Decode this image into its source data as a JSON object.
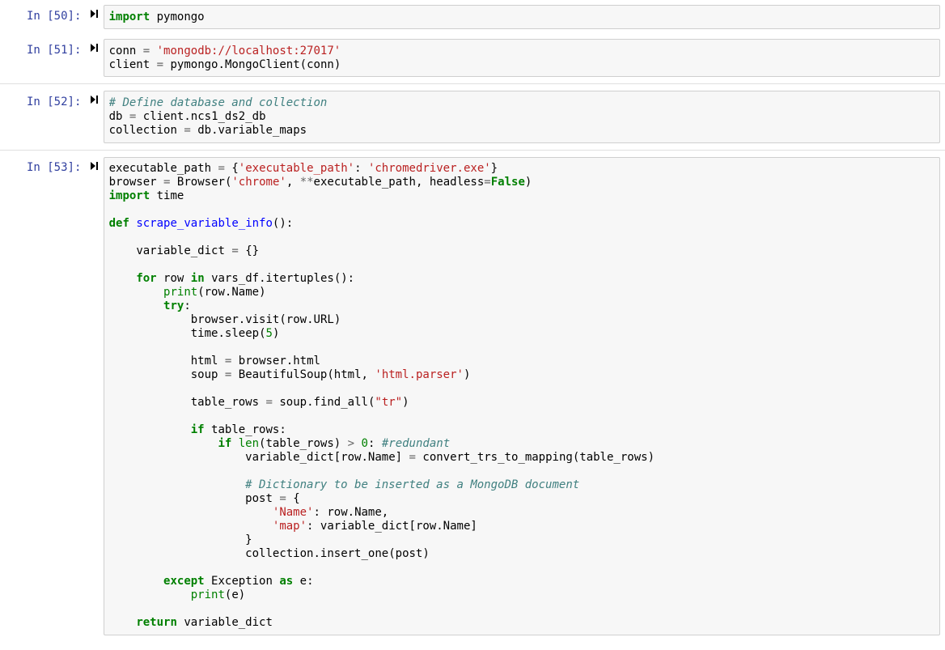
{
  "cells": [
    {
      "prompt": "In [50]:",
      "code_html": "<span class=\"k\">import</span> <span class=\"nn\">pymongo</span>"
    },
    {
      "prompt": "In [51]:",
      "code_html": "<span class=\"n\">conn</span> <span class=\"o\">=</span> <span class=\"s\">'mongodb://localhost:27017'</span>\n<span class=\"n\">client</span> <span class=\"o\">=</span> <span class=\"n\">pymongo</span><span class=\"p\">.</span><span class=\"n\">MongoClient</span><span class=\"p\">(</span><span class=\"n\">conn</span><span class=\"p\">)</span>"
    },
    {
      "prompt": "In [52]:",
      "code_html": "<span class=\"c\"># Define database and collection</span>\n<span class=\"n\">db</span> <span class=\"o\">=</span> <span class=\"n\">client</span><span class=\"p\">.</span><span class=\"n\">ncs1_ds2_db</span>\n<span class=\"n\">collection</span> <span class=\"o\">=</span> <span class=\"n\">db</span><span class=\"p\">.</span><span class=\"n\">variable_maps</span>"
    },
    {
      "prompt": "In [53]:",
      "code_html": "<span class=\"n\">executable_path</span> <span class=\"o\">=</span> <span class=\"p\">{</span><span class=\"s\">'executable_path'</span><span class=\"p\">:</span> <span class=\"s\">'chromedriver.exe'</span><span class=\"p\">}</span>\n<span class=\"n\">browser</span> <span class=\"o\">=</span> <span class=\"n\">Browser</span><span class=\"p\">(</span><span class=\"s\">'chrome'</span><span class=\"p\">,</span> <span class=\"o\">**</span><span class=\"n\">executable_path</span><span class=\"p\">,</span> <span class=\"n\">headless</span><span class=\"o\">=</span><span class=\"kc\">False</span><span class=\"p\">)</span>\n<span class=\"k\">import</span> <span class=\"nn\">time</span>\n\n<span class=\"k\">def</span> <span class=\"nf\">scrape_variable_info</span><span class=\"p\">():</span>\n\n    <span class=\"n\">variable_dict</span> <span class=\"o\">=</span> <span class=\"p\">{}</span>\n\n    <span class=\"k\">for</span> <span class=\"n\">row</span> <span class=\"k\">in</span> <span class=\"n\">vars_df</span><span class=\"p\">.</span><span class=\"n\">itertuples</span><span class=\"p\">():</span>\n        <span class=\"nb\">print</span><span class=\"p\">(</span><span class=\"n\">row</span><span class=\"p\">.</span><span class=\"n\">Name</span><span class=\"p\">)</span>\n        <span class=\"k\">try</span><span class=\"p\">:</span>\n            <span class=\"n\">browser</span><span class=\"p\">.</span><span class=\"n\">visit</span><span class=\"p\">(</span><span class=\"n\">row</span><span class=\"p\">.</span><span class=\"n\">URL</span><span class=\"p\">)</span>\n            <span class=\"n\">time</span><span class=\"p\">.</span><span class=\"n\">sleep</span><span class=\"p\">(</span><span class=\"mi\">5</span><span class=\"p\">)</span>\n\n            <span class=\"n\">html</span> <span class=\"o\">=</span> <span class=\"n\">browser</span><span class=\"p\">.</span><span class=\"n\">html</span>\n            <span class=\"n\">soup</span> <span class=\"o\">=</span> <span class=\"n\">BeautifulSoup</span><span class=\"p\">(</span><span class=\"n\">html</span><span class=\"p\">,</span> <span class=\"s\">'html.parser'</span><span class=\"p\">)</span>\n\n            <span class=\"n\">table_rows</span> <span class=\"o\">=</span> <span class=\"n\">soup</span><span class=\"p\">.</span><span class=\"n\">find_all</span><span class=\"p\">(</span><span class=\"s\">\"tr\"</span><span class=\"p\">)</span>\n\n            <span class=\"k\">if</span> <span class=\"n\">table_rows</span><span class=\"p\">:</span>\n                <span class=\"k\">if</span> <span class=\"nb\">len</span><span class=\"p\">(</span><span class=\"n\">table_rows</span><span class=\"p\">)</span> <span class=\"o\">&gt;</span> <span class=\"mi\">0</span><span class=\"p\">:</span> <span class=\"c\">#redundant</span>\n                    <span class=\"n\">variable_dict</span><span class=\"p\">[</span><span class=\"n\">row</span><span class=\"p\">.</span><span class=\"n\">Name</span><span class=\"p\">]</span> <span class=\"o\">=</span> <span class=\"n\">convert_trs_to_mapping</span><span class=\"p\">(</span><span class=\"n\">table_rows</span><span class=\"p\">)</span>\n\n                    <span class=\"c\"># Dictionary to be inserted as a MongoDB document</span>\n                    <span class=\"n\">post</span> <span class=\"o\">=</span> <span class=\"p\">{</span>\n                        <span class=\"s\">'Name'</span><span class=\"p\">:</span> <span class=\"n\">row</span><span class=\"p\">.</span><span class=\"n\">Name</span><span class=\"p\">,</span>\n                        <span class=\"s\">'map'</span><span class=\"p\">:</span> <span class=\"n\">variable_dict</span><span class=\"p\">[</span><span class=\"n\">row</span><span class=\"p\">.</span><span class=\"n\">Name</span><span class=\"p\">]</span>\n                    <span class=\"p\">}</span>\n                    <span class=\"n\">collection</span><span class=\"p\">.</span><span class=\"n\">insert_one</span><span class=\"p\">(</span><span class=\"n\">post</span><span class=\"p\">)</span>\n\n        <span class=\"k\">except</span> <span class=\"n\">Exception</span> <span class=\"k\">as</span> <span class=\"n\">e</span><span class=\"p\">:</span>\n            <span class=\"nb\">print</span><span class=\"p\">(</span><span class=\"n\">e</span><span class=\"p\">)</span>\n\n    <span class=\"k\">return</span> <span class=\"n\">variable_dict</span>"
    }
  ],
  "run_icon": "▶|"
}
